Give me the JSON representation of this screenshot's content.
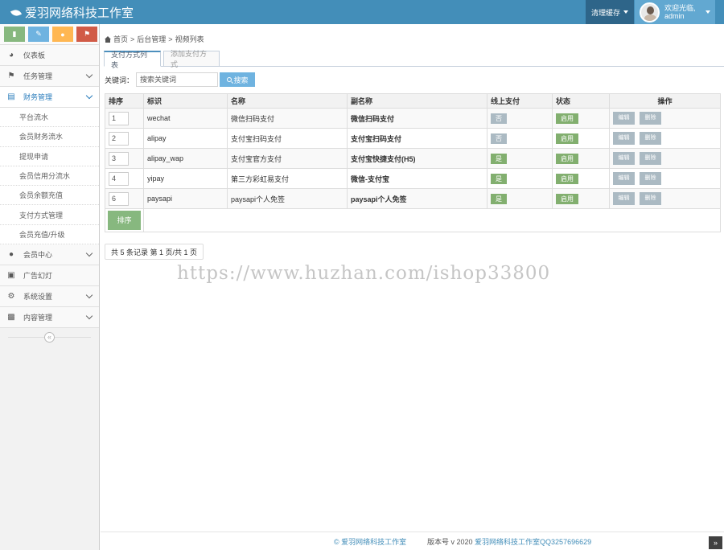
{
  "header": {
    "brand": "爱羽网络科技工作室",
    "clear_cache": "清理缓存",
    "welcome": "欢迎光临,",
    "username": "admin"
  },
  "sidebar": {
    "shortcuts": [
      "signal-icon",
      "pencil-icon",
      "users-icon",
      "bell-icon"
    ],
    "menu": [
      {
        "label": "仪表板",
        "icon": "dashboard-icon",
        "expandable": false
      },
      {
        "label": "任务管理",
        "icon": "flag-icon",
        "expandable": true
      },
      {
        "label": "财务管理",
        "icon": "money-icon",
        "expandable": true,
        "active": true
      }
    ],
    "submenu": [
      "平台流水",
      "会员财务流水",
      "提现申请",
      "会员信用分流水",
      "会员余额充值",
      "支付方式管理",
      "会员充值/升级"
    ],
    "menu2": [
      {
        "label": "会员中心",
        "icon": "user-icon"
      },
      {
        "label": "广告幻灯",
        "icon": "picture-icon"
      },
      {
        "label": "系统设置",
        "icon": "cog-icon"
      },
      {
        "label": "内容管理",
        "icon": "book-icon"
      }
    ]
  },
  "breadcrumb": {
    "home": "首页",
    "level2": "后台管理",
    "level3": "视频列表",
    "sep": ">"
  },
  "tabs": {
    "active": "支付方式列表",
    "inactive": "添加支付方式"
  },
  "search": {
    "label": "关键词：",
    "placeholder": "搜索关键词",
    "button": "搜索"
  },
  "table": {
    "headers": [
      "排序",
      "标识",
      "名称",
      "副名称",
      "线上支付",
      "状态",
      "操作"
    ],
    "rows": [
      {
        "sort": "1",
        "id": "wechat",
        "name": "微信扫码支付",
        "subname": "微信扫码支付",
        "online": "否",
        "status": "启用"
      },
      {
        "sort": "2",
        "id": "alipay",
        "name": "支付宝扫码支付",
        "subname": "支付宝扫码支付",
        "online": "否",
        "status": "启用"
      },
      {
        "sort": "3",
        "id": "alipay_wap",
        "name": "支付宝官方支付",
        "subname": "支付宝快捷支付(H5)",
        "online": "是",
        "status": "启用"
      },
      {
        "sort": "4",
        "id": "yipay",
        "name": "第三方彩虹易支付",
        "subname": "微信-支付宝",
        "online": "是",
        "status": "启用"
      },
      {
        "sort": "6",
        "id": "paysapi",
        "name": "paysapi个人免签",
        "subname": "paysapi个人免签",
        "online": "是",
        "status": "启用"
      }
    ],
    "edit_label": "编辑",
    "delete_label": "删除",
    "sort_button": "排序"
  },
  "pager": {
    "text": "共 5 条记录 第 1 页/共 1 页"
  },
  "watermark": "https://www.huzhan.com/ishop33800",
  "footer": {
    "copyright": "© 爱羽网络科技工作室",
    "version_prefix": "版本号 v 2020",
    "version_link": "爱羽网络科技工作室QQ3257696629"
  },
  "colors": {
    "topbar": "#438eb9",
    "accent": "#2b7dbc",
    "green": "#87b87f",
    "grey_badge": "#abbac3"
  }
}
